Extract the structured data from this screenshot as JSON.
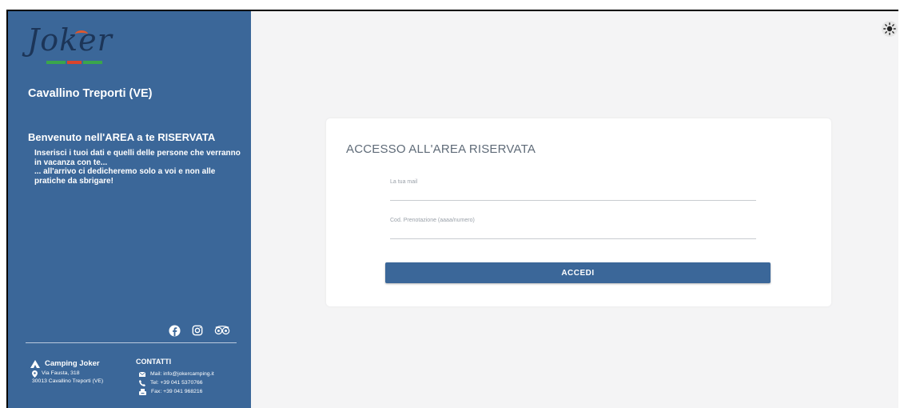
{
  "sidebar": {
    "logo_text": "Joker",
    "location": "Cavallino Treporti (VE)",
    "welcome_title": "Benvenuto nell'AREA a te RISERVATA",
    "welcome_lines": [
      "Inserisci i tuoi dati e quelli delle persone che verranno",
      "in vacanza con te...",
      "... all'arrivo ci dedicheremo solo a voi e non alle",
      "pratiche da sbrigare!"
    ],
    "social_icons": [
      "facebook-icon",
      "instagram-icon",
      "tripadvisor-icon"
    ]
  },
  "footer": {
    "brand": "Camping Joker",
    "address_line1": "Via Fausta, 318",
    "address_line2": "30013 Cavallino Treporti (VE)",
    "contacts_title": "CONTATTI",
    "mail": "Mail: info@jokercamping.it",
    "tel": "Tel: +39 041 5370766",
    "fax": "Fax: +39 041 968216"
  },
  "login": {
    "title": "ACCESSO ALL'AREA RISERVATA",
    "email_label": "La tua mail",
    "email_value": "",
    "booking_label": "Cod. Prenotazione (aaaa/numero)",
    "booking_value": "",
    "submit_label": "ACCEDI"
  },
  "theme": {
    "icon": "sun-icon"
  },
  "colors": {
    "brand_blue": "#3b6799",
    "background": "#f4f4f5",
    "card": "#ffffff"
  }
}
